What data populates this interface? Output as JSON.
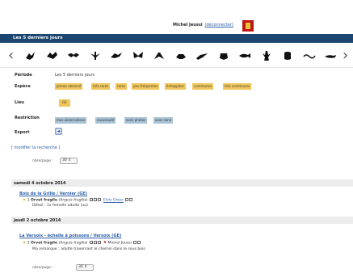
{
  "header": {
    "user_name": "Michel Jeussi",
    "logout_label": "(déconnecter)"
  },
  "title": "Les 5 derniers jours",
  "icons": [
    "bird-icon",
    "raptor-icon",
    "bat-icon",
    "dragonfly-icon",
    "bird-flying-icon",
    "butterfly-icon",
    "grasshopper-icon",
    "beetle-icon",
    "cricket-icon",
    "bug-icon",
    "fish-icon",
    "crayfish-icon",
    "snail-icon",
    "worm-icon",
    "slug-icon"
  ],
  "filters": {
    "period_label": "Période",
    "period_value": "Les 5 derniers jours",
    "species_label": "Espèce",
    "species_chips": [
      "jamais observé",
      "très rares",
      "rares",
      "peu fréquentes",
      "échappées",
      "communes",
      "très communes"
    ],
    "place_label": "Lieu",
    "place_chip": "GE",
    "restriction_label": "Restriction",
    "restriction_chips": [
      "mes observations",
      "nouveauté",
      "avec photos",
      "avec sons"
    ],
    "export_label": "Export"
  },
  "modify_link": "[ modifier la recherche ]",
  "pagination": {
    "label": "nbre/page :",
    "value": "30 ⇕"
  },
  "days": [
    {
      "date": "samedi 4 octobre 2014",
      "place": "Bois de la Grille / Vernier (GE)",
      "obs_count": "1",
      "species": "Orvet fragile",
      "latin": "(Anguis fragilis)",
      "observer": "Elvis Greer",
      "detail": "Détail : 1x femelle adulte (vu)"
    },
    {
      "date": "jeudi 2 octobre 2014",
      "place": "La Versoix - échelle à poissons / Versoix (GE)",
      "obs_count": "1",
      "species": "Orvet fragile",
      "latin": "(Anguis fragilis)",
      "observer": "Michel Jeussi",
      "detail": "Ma remarque : adulte traversant le chemin dans le sous bois"
    }
  ]
}
